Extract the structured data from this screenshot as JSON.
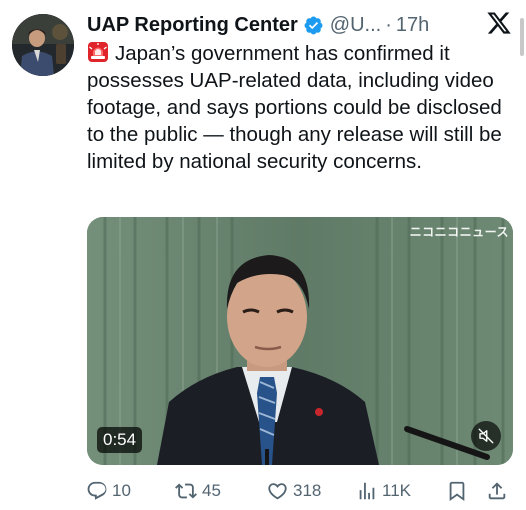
{
  "tweet": {
    "author_name": "UAP Reporting Center",
    "handle": "@U...",
    "separator": "·",
    "timestamp": "17h",
    "text": "Japan’s government has confirmed it possesses UAP-related data, including video footage, and says portions could be disclosed to the public — though any release will still be limited by national security concerns."
  },
  "media": {
    "watermark": "ニコニコニュース",
    "duration": "0:54"
  },
  "actions": {
    "replies": "10",
    "reposts": "45",
    "likes": "318",
    "views": "11K"
  },
  "icons": {
    "verified": "verified-badge-icon",
    "siren": "police-light-emoji-icon",
    "x_logo": "x-logo-icon",
    "mute": "speaker-muted-icon",
    "reply": "reply-icon",
    "repost": "repost-icon",
    "like": "heart-icon",
    "views": "analytics-icon",
    "bookmark": "bookmark-icon",
    "share": "share-icon"
  },
  "colors": {
    "verified_blue": "#1d9bf0",
    "secondary_text": "#536471",
    "primary_text": "#0f1419",
    "siren_red": "#e0242b"
  }
}
